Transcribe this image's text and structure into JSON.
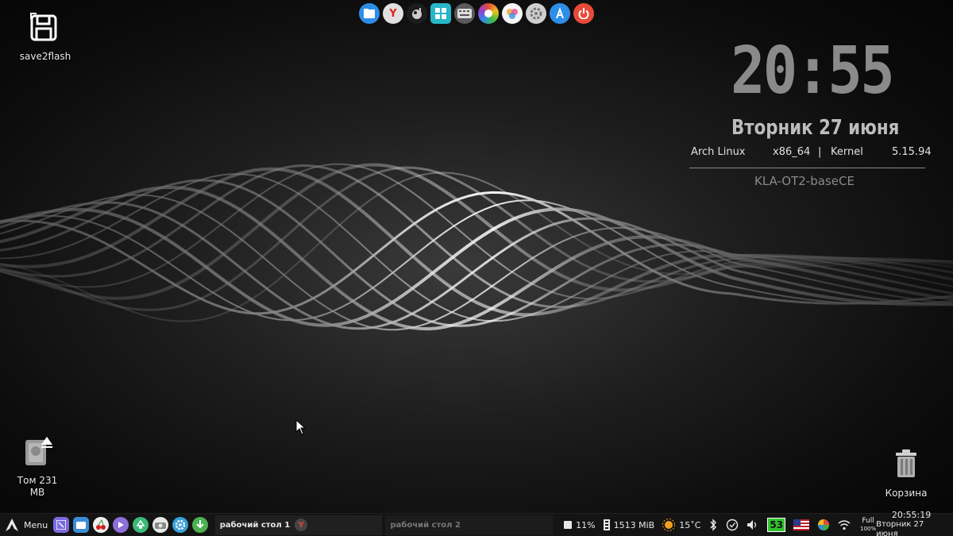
{
  "desktop": {
    "icons": [
      {
        "label": "save2flash"
      },
      {
        "label": "Том 231\nMB"
      },
      {
        "label": "Корзина"
      }
    ]
  },
  "dock": {
    "apps": [
      {
        "icon": "file-manager-icon",
        "color": "#2d8ee8"
      },
      {
        "icon": "yandex-browser-icon",
        "color": "#e0e0e0"
      },
      {
        "icon": "gimp-icon",
        "color": "#1c1c1c"
      },
      {
        "icon": "settings-panel-icon",
        "color": "#29b6c9"
      },
      {
        "icon": "keyboard-icon",
        "color": "#5a5a5a"
      },
      {
        "icon": "color-picker-icon",
        "color": "#f0f0f0"
      },
      {
        "icon": "photos-icon",
        "color": "#f5f5f5"
      },
      {
        "icon": "system-settings-icon",
        "color": "#d0d0d0"
      },
      {
        "icon": "app-store-icon",
        "color": "#2d8ee8"
      },
      {
        "icon": "power-icon",
        "color": "#e84a3a"
      }
    ]
  },
  "conky": {
    "time": "20:55",
    "date": "Вторник 27 июня",
    "os": "Arch Linux",
    "arch": "x86_64",
    "separator": "|",
    "kernel_label": "Kernel",
    "kernel_version": "5.15.94",
    "hostname": "KLA-OT2-baseCE"
  },
  "taskbar": {
    "menu_label": "Menu",
    "launchers": [
      {
        "icon": "terminal-icon",
        "color": "#7b6be0"
      },
      {
        "icon": "files-icon",
        "color": "#3a8fd8"
      },
      {
        "icon": "cherry-icon",
        "color": "#f0f0f0"
      },
      {
        "icon": "media-player-icon",
        "color": "#8e6fd8"
      },
      {
        "icon": "recycle-icon",
        "color": "#3cb878"
      },
      {
        "icon": "camera-icon",
        "color": "#e8e8e8"
      },
      {
        "icon": "gear-icon",
        "color": "#3aa0d8"
      },
      {
        "icon": "download-icon",
        "color": "#4caf50"
      }
    ],
    "workspace_1": "рабочий стол 1",
    "workspace_2": "рабочий стол 2",
    "cpu": "11%",
    "memory": "1513 MiB",
    "temperature": "15˚C",
    "notification_count": "53",
    "battery_status": "Full",
    "battery_percent": "100%",
    "clock_time": "20:55:19",
    "clock_date": "Вторник 27 июня"
  }
}
